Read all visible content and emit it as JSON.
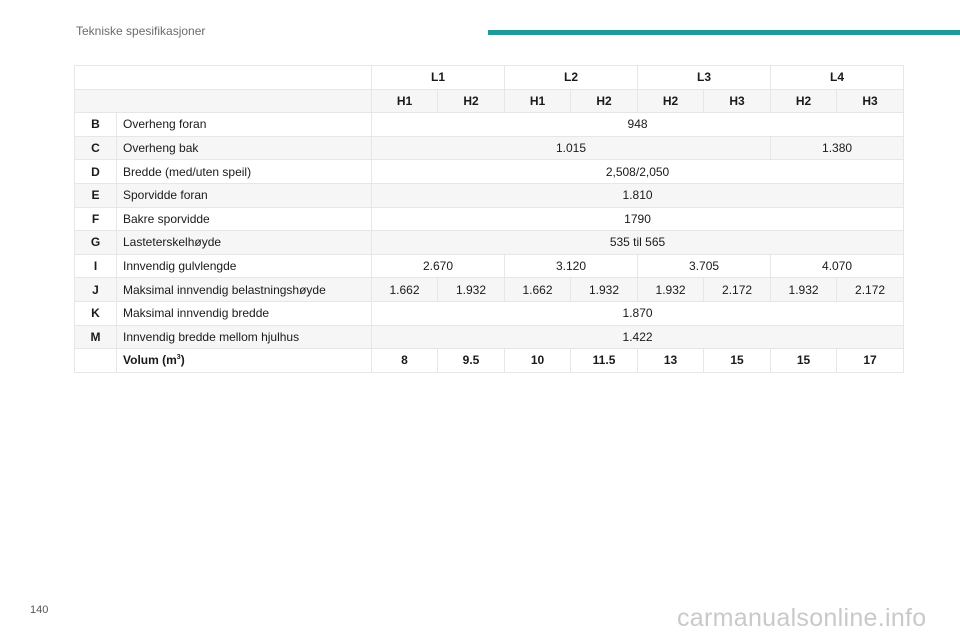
{
  "header": {
    "section_title": "Tekniske spesifikasjoner",
    "accent_color": "#1f9a9a"
  },
  "table": {
    "lengths": [
      "L1",
      "L2",
      "L3",
      "L4"
    ],
    "heights": [
      "H1",
      "H2",
      "H1",
      "H2",
      "H2",
      "H3",
      "H2",
      "H3"
    ],
    "rows": [
      {
        "code": "B",
        "label": "Overheng foran",
        "values": [
          "948"
        ]
      },
      {
        "code": "C",
        "label": "Overheng bak",
        "values": [
          "1.015",
          "1.380"
        ]
      },
      {
        "code": "D",
        "label": "Bredde (med/uten speil)",
        "values": [
          "2,508/2,050"
        ]
      },
      {
        "code": "E",
        "label": "Sporvidde foran",
        "values": [
          "1.810"
        ]
      },
      {
        "code": "F",
        "label": "Bakre sporvidde",
        "values": [
          "1790"
        ]
      },
      {
        "code": "G",
        "label": "Lasteterskelhøyde",
        "values": [
          "535 til 565"
        ]
      },
      {
        "code": "I",
        "label": "Innvendig gulvlengde",
        "values": [
          "2.670",
          "3.120",
          "3.705",
          "4.070"
        ]
      },
      {
        "code": "J",
        "label": "Maksimal innvendig belastningshøyde",
        "values": [
          "1.662",
          "1.932",
          "1.662",
          "1.932",
          "1.932",
          "2.172",
          "1.932",
          "2.172"
        ]
      },
      {
        "code": "K",
        "label": "Maksimal innvendig bredde",
        "values": [
          "1.870"
        ]
      },
      {
        "code": "M",
        "label": "Innvendig bredde mellom hjulhus",
        "values": [
          "1.422"
        ]
      }
    ],
    "volume": {
      "label": "Volum (m",
      "unit_sup": "3",
      "label_close": ")",
      "values": [
        "8",
        "9.5",
        "10",
        "11.5",
        "13",
        "15",
        "15",
        "17"
      ]
    }
  },
  "footer": {
    "page_number": "140",
    "watermark": "carmanualsonline.info"
  }
}
